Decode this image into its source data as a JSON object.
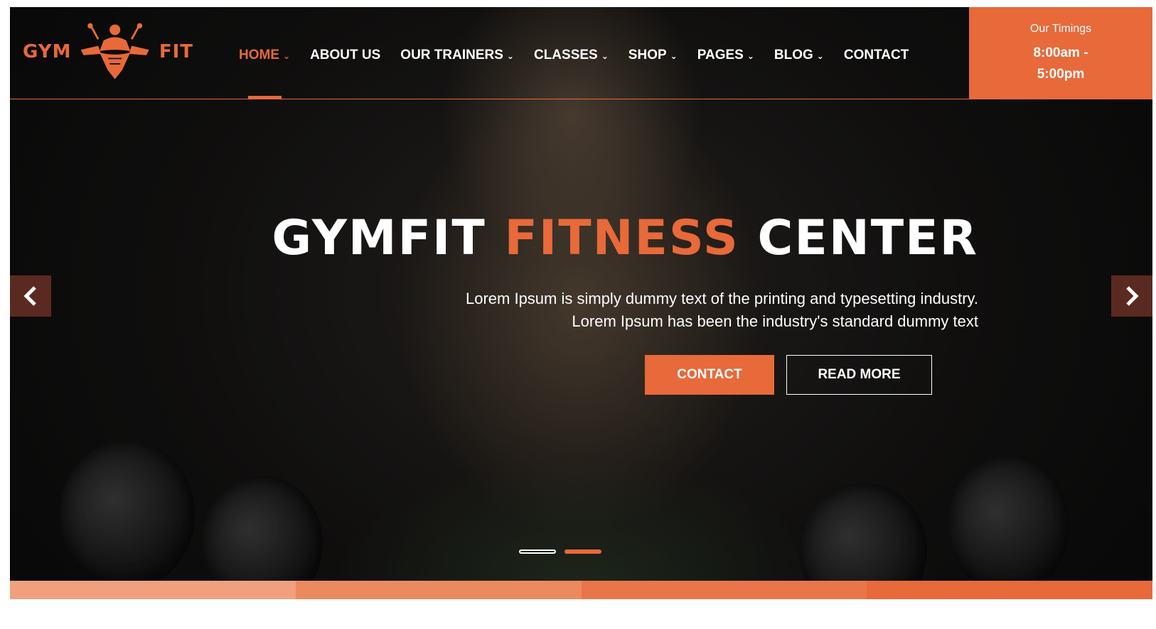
{
  "logo": {
    "left_text": "GYM",
    "right_text": "FIT"
  },
  "nav": {
    "items": [
      {
        "label": "HOME",
        "dropdown": true,
        "active": true
      },
      {
        "label": "ABOUT US",
        "dropdown": false
      },
      {
        "label": "OUR TRAINERS",
        "dropdown": true
      },
      {
        "label": "CLASSES",
        "dropdown": true
      },
      {
        "label": "SHOP",
        "dropdown": true
      },
      {
        "label": "PAGES",
        "dropdown": true
      },
      {
        "label": "BLOG",
        "dropdown": true
      },
      {
        "label": "CONTACT",
        "dropdown": false
      }
    ]
  },
  "timings": {
    "label": "Our Timings",
    "line1": "8:00am -",
    "line2": "5:00pm"
  },
  "hero": {
    "title_part1": "GYMFIT",
    "title_part2": "FITNESS",
    "title_part3": "CENTER",
    "subtitle_line1": "Lorem Ipsum is simply dummy text of the printing and typesetting industry.",
    "subtitle_line2": "Lorem Ipsum has been the industry's standard dummy text",
    "contact_button": "CONTACT",
    "read_more_button": "READ MORE"
  },
  "slider": {
    "slides": 2,
    "active_index": 1
  },
  "colors": {
    "accent": "#e8693a",
    "arrow_bg": "#5a2a20",
    "strip": [
      "#f0a07d",
      "#eb8a5e",
      "#e8764a",
      "#e8693a"
    ]
  },
  "icons": {
    "prev": "chevron-left-icon",
    "next": "chevron-right-icon",
    "dropdown": "chevron-down-icon"
  }
}
